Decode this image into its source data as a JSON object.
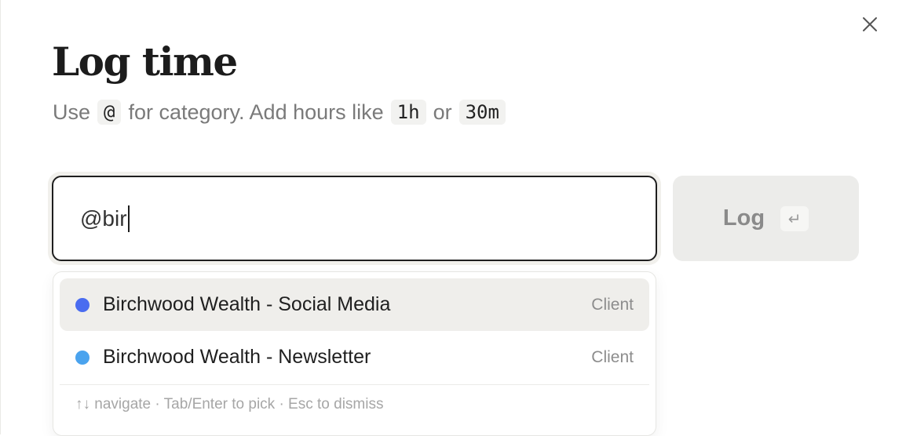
{
  "dialog": {
    "title": "Log time",
    "subtitle": {
      "part1": "Use",
      "code1": "@",
      "part2": "for category. Add hours like",
      "code2": "1h",
      "part3": "or",
      "code3": "30m"
    },
    "close_icon": "close-icon"
  },
  "input": {
    "value": "@bir"
  },
  "log_button": {
    "label": "Log",
    "shortcut": "↵"
  },
  "suggestions": {
    "items": [
      {
        "name": "Birchwood Wealth - Social Media",
        "tag": "Client",
        "color": "#4a6cf0",
        "active": true
      },
      {
        "name": "Birchwood Wealth - Newsletter",
        "tag": "Client",
        "color": "#4aa3ee",
        "active": false
      }
    ],
    "hint": "↑↓ navigate · Tab/Enter to pick · Esc to dismiss"
  }
}
